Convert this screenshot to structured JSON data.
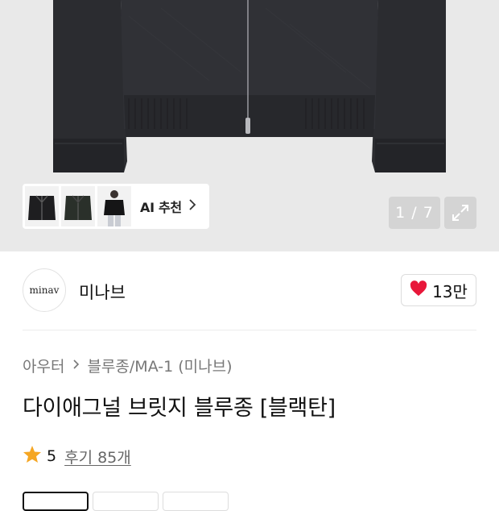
{
  "hero": {
    "ai_recommend": {
      "label": "AI 추천",
      "chevron_icon": "chevron-right-icon",
      "thumbnails": [
        "jacket-thumb-1",
        "jacket-thumb-2",
        "model-thumb-3"
      ]
    },
    "image_counter": "1 / 7",
    "expand_icon": "expand-icon"
  },
  "brand": {
    "logo_text": "minav",
    "name": "미나브",
    "like_icon": "heart-icon",
    "like_count": "13만",
    "like_color": "#e8173a"
  },
  "breadcrumb": {
    "category": "아우터",
    "subcategory": "블루종/MA-1 (미나브)"
  },
  "product": {
    "title": "다이애그널 브릿지 블루종 [블랙탄]"
  },
  "rating": {
    "star_icon": "star-icon",
    "star_color": "#f5a623",
    "score": "5",
    "review_link": "후기 85개"
  }
}
